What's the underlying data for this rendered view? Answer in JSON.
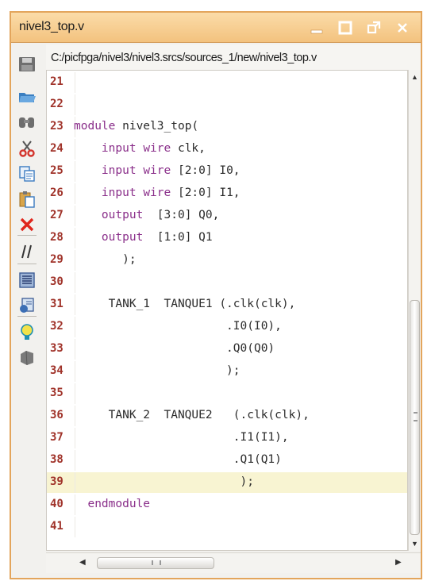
{
  "window": {
    "title": "nivel3_top.v",
    "minimize_glyph": "_",
    "close_glyph": "×"
  },
  "file_path": "C:/picfpga/nivel3/nivel3.srcs/sources_1/new/nivel3_top.v",
  "toolbar_icons": [
    "save-icon",
    "open-icon",
    "find-icon",
    "cut-icon",
    "copy-icon",
    "paste-icon",
    "delete-icon",
    "comment-icon",
    "indent-icon",
    "template-icon",
    "lightbulb-icon",
    "tool-icon"
  ],
  "colors": {
    "line_number": "#a0332a",
    "keyword": "#8a2f8a",
    "title_bar": "#f3c27e",
    "current_line": "#f8f4d2"
  },
  "lines": [
    {
      "num": "21",
      "code": ""
    },
    {
      "num": "22",
      "code": ""
    },
    {
      "num": "23",
      "code": "module nivel3_top("
    },
    {
      "num": "24",
      "code": "    input wire clk,"
    },
    {
      "num": "25",
      "code": "    input wire [2:0] I0,"
    },
    {
      "num": "26",
      "code": "    input wire [2:0] I1,"
    },
    {
      "num": "27",
      "code": "    output  [3:0] Q0,"
    },
    {
      "num": "28",
      "code": "    output  [1:0] Q1"
    },
    {
      "num": "29",
      "code": "       );"
    },
    {
      "num": "30",
      "code": ""
    },
    {
      "num": "31",
      "code": "     TANK_1  TANQUE1 (.clk(clk),"
    },
    {
      "num": "32",
      "code": "                      .I0(I0),"
    },
    {
      "num": "33",
      "code": "                      .Q0(Q0)"
    },
    {
      "num": "34",
      "code": "                      );"
    },
    {
      "num": "35",
      "code": ""
    },
    {
      "num": "36",
      "code": "     TANK_2  TANQUE2   (.clk(clk),"
    },
    {
      "num": "37",
      "code": "                       .I1(I1),"
    },
    {
      "num": "38",
      "code": "                       .Q1(Q1)"
    },
    {
      "num": "39",
      "code": "                        );"
    },
    {
      "num": "40",
      "code": "  endmodule"
    },
    {
      "num": "41",
      "code": ""
    }
  ],
  "current_line": "39",
  "scrollbar": {
    "h_grip": "III",
    "v_grip": "≡"
  }
}
